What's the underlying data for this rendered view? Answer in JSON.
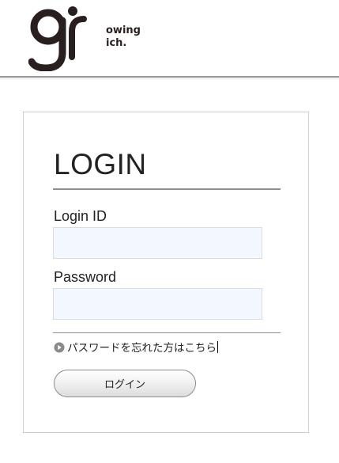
{
  "header": {
    "logo": {
      "mark": "g",
      "text_line1": "owing",
      "text_line2": "ich.",
      "color": "#2a1f1f"
    }
  },
  "login": {
    "title": "LOGIN",
    "id_label": "Login ID",
    "id_value": "",
    "id_placeholder": "",
    "password_label": "Password",
    "password_value": "",
    "password_placeholder": "",
    "forgot_link": "パスワードを忘れた方はこちら",
    "forgot_icon": "circle-arrow-right-icon",
    "submit_label": "ログイン"
  },
  "colors": {
    "input_background": "#f3f7ff",
    "rule": "#8f8f8f",
    "header_line": "#9a9a9a"
  }
}
